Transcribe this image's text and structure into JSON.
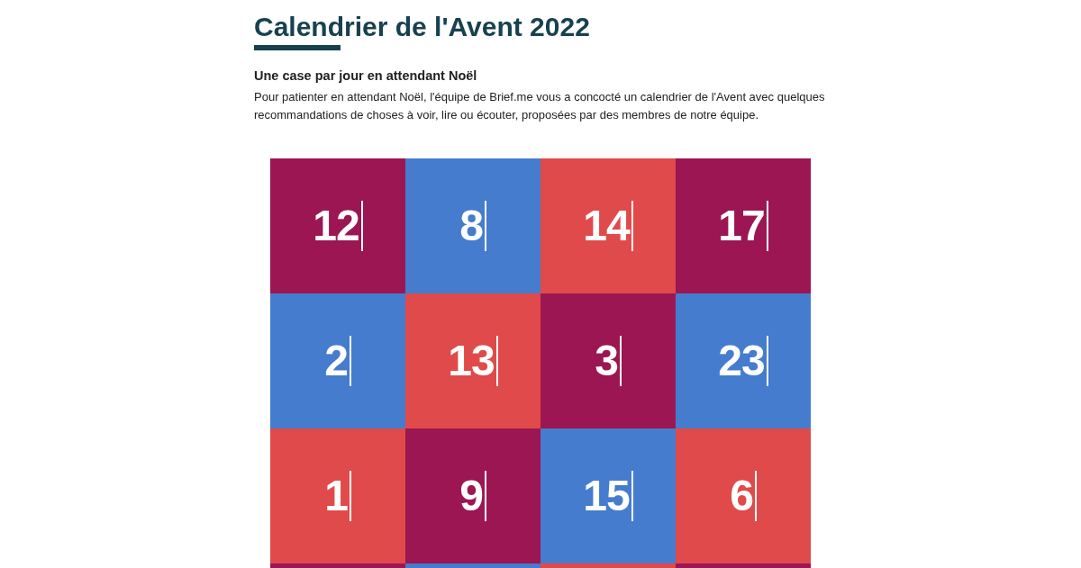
{
  "title": "Calendrier de l'Avent 2022",
  "subtitle": "Une case par jour en attendant Noël",
  "intro": "Pour patienter en attendant Noël, l'équipe de Brief.me vous a concocté un calendrier de l'Avent avec quelques recommandations de choses à voir, lire ou écouter, proposées par des membres de notre équipe.",
  "tiles": [
    {
      "number": "12",
      "color": "#9b1652"
    },
    {
      "number": "8",
      "color": "#457ccd"
    },
    {
      "number": "14",
      "color": "#e04a4a"
    },
    {
      "number": "17",
      "color": "#9b1652"
    },
    {
      "number": "2",
      "color": "#457ccd"
    },
    {
      "number": "13",
      "color": "#e04a4a"
    },
    {
      "number": "3",
      "color": "#9b1652"
    },
    {
      "number": "23",
      "color": "#457ccd"
    },
    {
      "number": "1",
      "color": "#e04a4a"
    },
    {
      "number": "9",
      "color": "#9b1652"
    },
    {
      "number": "15",
      "color": "#457ccd"
    },
    {
      "number": "6",
      "color": "#e04a4a"
    },
    {
      "color": "#9b1652"
    },
    {
      "color": "#457ccd"
    },
    {
      "color": "#e04a4a"
    },
    {
      "color": "#9b1652"
    }
  ]
}
